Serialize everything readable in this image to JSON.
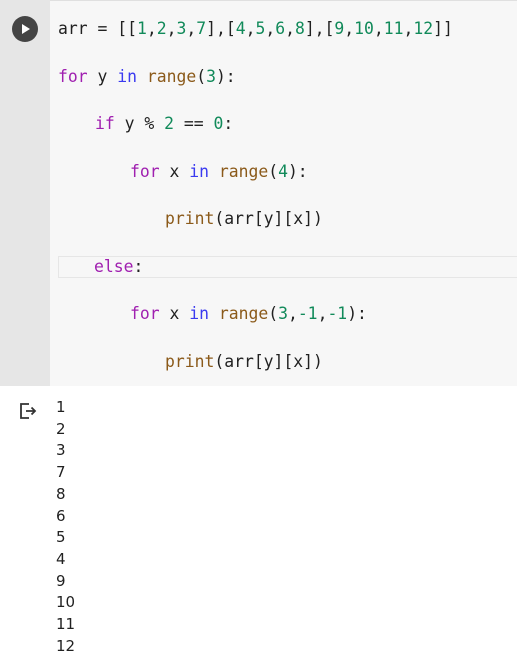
{
  "code": {
    "lines": [
      {
        "segs": [
          {
            "t": "arr = [[",
            "c": ""
          },
          {
            "t": "1",
            "c": "num"
          },
          {
            "t": ",",
            "c": ""
          },
          {
            "t": "2",
            "c": "num"
          },
          {
            "t": ",",
            "c": ""
          },
          {
            "t": "3",
            "c": "num"
          },
          {
            "t": ",",
            "c": ""
          },
          {
            "t": "7",
            "c": "num"
          },
          {
            "t": "],[",
            "c": ""
          },
          {
            "t": "4",
            "c": "num"
          },
          {
            "t": ",",
            "c": ""
          },
          {
            "t": "5",
            "c": "num"
          },
          {
            "t": ",",
            "c": ""
          },
          {
            "t": "6",
            "c": "num"
          },
          {
            "t": ",",
            "c": ""
          },
          {
            "t": "8",
            "c": "num"
          },
          {
            "t": "],[",
            "c": ""
          },
          {
            "t": "9",
            "c": "num"
          },
          {
            "t": ",",
            "c": ""
          },
          {
            "t": "10",
            "c": "num"
          },
          {
            "t": ",",
            "c": ""
          },
          {
            "t": "11",
            "c": "num"
          },
          {
            "t": ",",
            "c": ""
          },
          {
            "t": "12",
            "c": "num"
          },
          {
            "t": "]]",
            "c": ""
          }
        ]
      },
      {
        "segs": [
          {
            "t": "for",
            "c": "kw2"
          },
          {
            "t": " y ",
            "c": ""
          },
          {
            "t": "in",
            "c": "kw"
          },
          {
            "t": " ",
            "c": ""
          },
          {
            "t": "range",
            "c": "fn"
          },
          {
            "t": "(",
            "c": ""
          },
          {
            "t": "3",
            "c": "num"
          },
          {
            "t": "):",
            "c": ""
          }
        ]
      },
      {
        "segs": [
          {
            "t": "if",
            "c": "kw2"
          },
          {
            "t": " y % ",
            "c": ""
          },
          {
            "t": "2",
            "c": "num"
          },
          {
            "t": " == ",
            "c": ""
          },
          {
            "t": "0",
            "c": "num"
          },
          {
            "t": ":",
            "c": ""
          }
        ]
      },
      {
        "segs": [
          {
            "t": "for",
            "c": "kw2"
          },
          {
            "t": " x ",
            "c": ""
          },
          {
            "t": "in",
            "c": "kw"
          },
          {
            "t": " ",
            "c": ""
          },
          {
            "t": "range",
            "c": "fn"
          },
          {
            "t": "(",
            "c": ""
          },
          {
            "t": "4",
            "c": "num"
          },
          {
            "t": "):",
            "c": ""
          }
        ]
      },
      {
        "segs": [
          {
            "t": "print",
            "c": "fn"
          },
          {
            "t": "(arr[y][x])",
            "c": ""
          }
        ]
      },
      {
        "segs": [
          {
            "t": "else",
            "c": "kw2"
          },
          {
            "t": ":",
            "c": ""
          }
        ]
      },
      {
        "segs": [
          {
            "t": "for",
            "c": "kw2"
          },
          {
            "t": " x ",
            "c": ""
          },
          {
            "t": "in",
            "c": "kw"
          },
          {
            "t": " ",
            "c": ""
          },
          {
            "t": "range",
            "c": "fn"
          },
          {
            "t": "(",
            "c": ""
          },
          {
            "t": "3",
            "c": "num"
          },
          {
            "t": ",",
            "c": ""
          },
          {
            "t": "-1",
            "c": "num"
          },
          {
            "t": ",",
            "c": ""
          },
          {
            "t": "-1",
            "c": "num"
          },
          {
            "t": "):",
            "c": ""
          }
        ]
      },
      {
        "segs": [
          {
            "t": "print",
            "c": "fn"
          },
          {
            "t": "(arr[y][x])",
            "c": ""
          }
        ]
      }
    ]
  },
  "output": {
    "icon": "output-arrow-icon",
    "lines": [
      "1",
      "2",
      "3",
      "7",
      "8",
      "6",
      "5",
      "4",
      "9",
      "10",
      "11",
      "12"
    ]
  },
  "colors": {
    "keyword_blue": "#3a3af0",
    "keyword_purple": "#a020b0",
    "builtin": "#8b5a1a",
    "number": "#118a5a",
    "gutter": "#e6e6e6",
    "editor_bg": "#f7f7f7"
  },
  "icons": {
    "run": "play-icon",
    "output": "output-arrow-icon"
  }
}
